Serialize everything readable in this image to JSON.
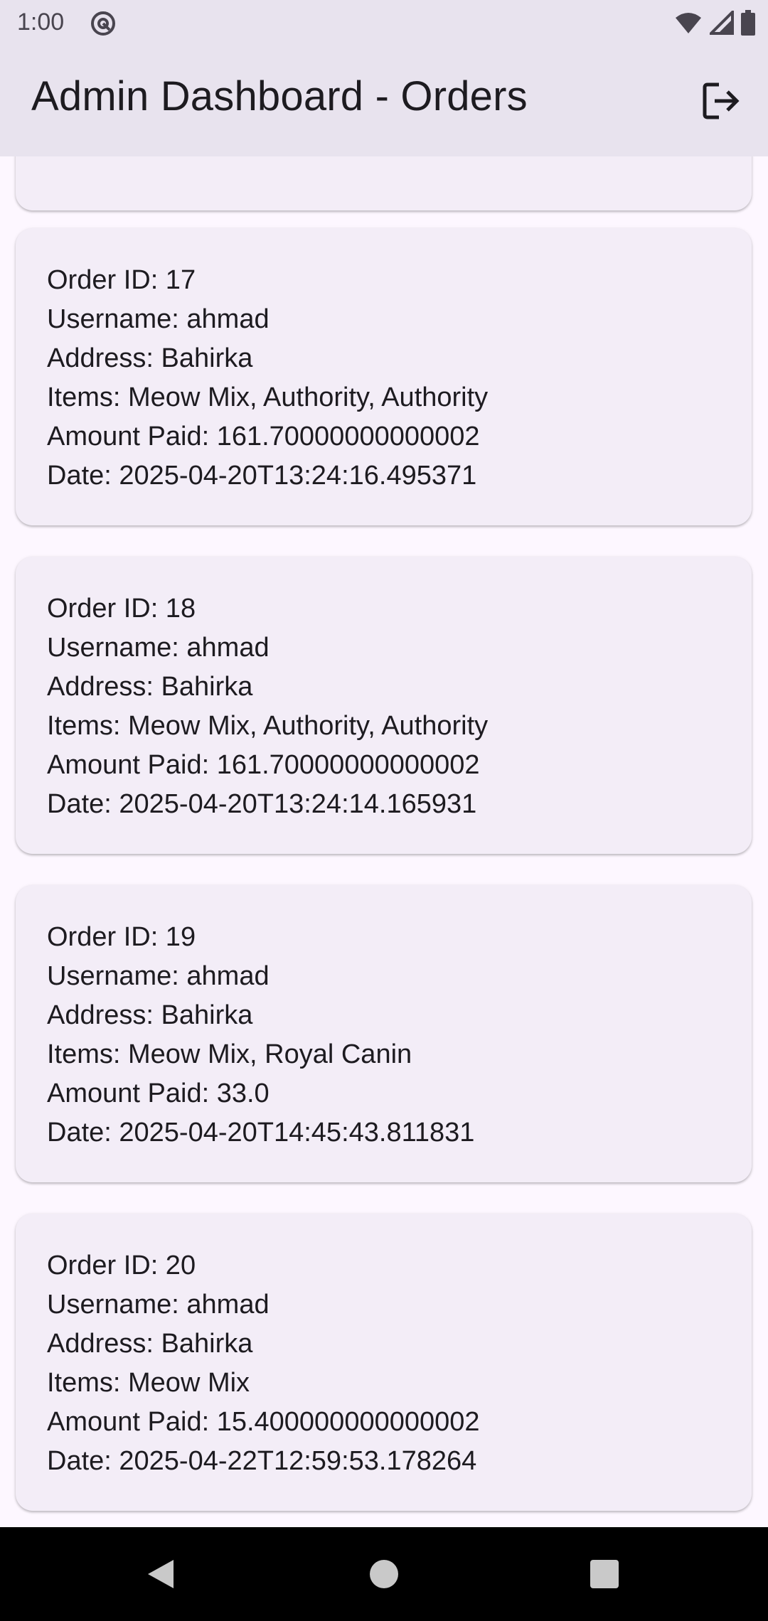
{
  "status_bar": {
    "time": "1:00",
    "icons": [
      "notification-at-icon",
      "wifi-icon",
      "signal-icon",
      "battery-icon"
    ]
  },
  "app_bar": {
    "title": "Admin Dashboard - Orders",
    "logout_icon": "logout-icon"
  },
  "orders": [
    {
      "id_line": "Order ID: 17",
      "username_line": "Username: ahmad",
      "address_line": "Address: Bahirka",
      "items_line": "Items: Meow Mix, Authority, Authority",
      "amount_line": "Amount Paid: 161.70000000000002",
      "date_line": "Date: 2025-04-20T13:24:16.495371"
    },
    {
      "id_line": "Order ID: 18",
      "username_line": "Username: ahmad",
      "address_line": "Address: Bahirka",
      "items_line": "Items: Meow Mix, Authority, Authority",
      "amount_line": "Amount Paid: 161.70000000000002",
      "date_line": "Date: 2025-04-20T13:24:14.165931"
    },
    {
      "id_line": "Order ID: 19",
      "username_line": "Username: ahmad",
      "address_line": "Address: Bahirka",
      "items_line": "Items: Meow Mix, Royal Canin",
      "amount_line": "Amount Paid: 33.0",
      "date_line": "Date: 2025-04-20T14:45:43.811831"
    },
    {
      "id_line": "Order ID: 20",
      "username_line": "Username: ahmad",
      "address_line": "Address: Bahirka",
      "items_line": "Items: Meow Mix",
      "amount_line": "Amount Paid: 15.400000000000002",
      "date_line": "Date: 2025-04-22T12:59:53.178264"
    }
  ],
  "nav_bar": {
    "icons": [
      "back-icon",
      "home-icon",
      "recents-icon"
    ]
  },
  "colors": {
    "app_bar_bg": "#e8e3ee",
    "page_bg": "#fdf7ff",
    "card_bg": "#f3edf7",
    "text": "#1d1b20",
    "nav_bar_bg": "#000000"
  }
}
